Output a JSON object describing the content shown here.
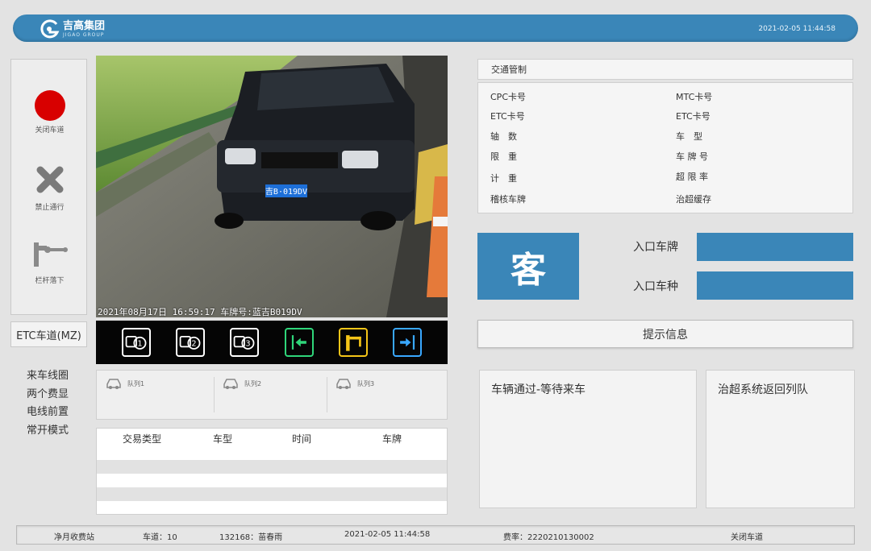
{
  "header": {
    "logo_cn": "吉高集团",
    "logo_en": "JIGAO GROUP",
    "datetime": "2021-02-05  11:44:58"
  },
  "controls": {
    "close_lane": "关闭车道",
    "forbid_pass": "禁止通行",
    "barrier_down": "栏杆落下"
  },
  "lane_label": "ETC车道(MZ)",
  "modes": [
    "来车线圈",
    "两个费显",
    "电线前置",
    "常开模式"
  ],
  "camera": {
    "overlay": "2021年08月17日  16:59:17  车牌号:蓝吉B019DV",
    "plate": "吉B·019DV"
  },
  "toolbar": {
    "btn1_icon": "vehicle-1-icon",
    "btn2_icon": "vehicle-2-icon",
    "btn3_icon": "vehicle-3-icon",
    "btn4_icon": "exit-left-icon",
    "btn5_icon": "barrier-gate-icon",
    "btn6_icon": "enter-right-icon",
    "colors": {
      "white": "#ffffff",
      "green": "#2fd67a",
      "yellow": "#f5c518",
      "blue": "#39a8ff"
    }
  },
  "queues": [
    "队列1",
    "队列2",
    "队列3"
  ],
  "transaction_table": {
    "headers": [
      "交易类型",
      "车型",
      "时间",
      "车牌"
    ],
    "rows": []
  },
  "traffic": {
    "title": "交通管制",
    "left": [
      "CPC卡号",
      "ETC卡号",
      "轴　数",
      "限　重",
      "计　重",
      "稽核车牌"
    ],
    "right": [
      "MTC卡号",
      "ETC卡号",
      "车　型",
      "车 牌 号",
      "超 限 率",
      "治超缓存"
    ]
  },
  "vehicle_class": "客",
  "entry": {
    "plate_label": "入口车牌",
    "type_label": "入口车种"
  },
  "tips_label": "提示信息",
  "messages": {
    "left": "车辆通过-等待来车",
    "right": "治超系统返回列队"
  },
  "status": {
    "station": "净月收费站",
    "lane": "车道：10",
    "operator": "132168：苗春雨",
    "datetime": "2021-02-05  11:44:58",
    "rate": "费率：2220210130002",
    "lane_state": "关闭车道"
  },
  "colors": {
    "primary": "#3a86b8",
    "alert_red": "#d80000",
    "background": "#e3e3e3"
  }
}
